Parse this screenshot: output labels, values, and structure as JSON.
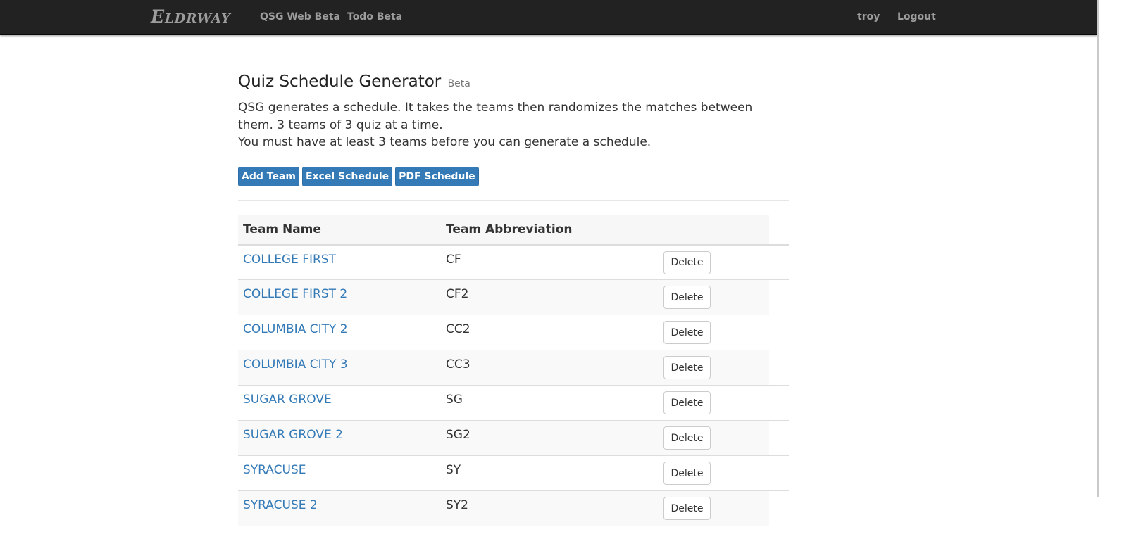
{
  "navbar": {
    "brand": "Eldrway",
    "links": [
      "QSG Web Beta",
      "Todo Beta"
    ],
    "user": "troy",
    "logout": "Logout"
  },
  "page": {
    "title": "Quiz Schedule Generator",
    "title_badge": "Beta",
    "description_1": "QSG generates a schedule. It takes the teams then randomizes the matches between them. 3 teams of 3 quiz at a time.",
    "description_2": "You must have at least 3 teams before you can generate a schedule."
  },
  "actions": {
    "add_team": "Add Team",
    "excel_schedule": "Excel Schedule",
    "pdf_schedule": "PDF Schedule"
  },
  "table": {
    "headers": [
      "Team Name",
      "Team Abbreviation",
      ""
    ],
    "delete_label": "Delete",
    "rows": [
      {
        "name": "COLLEGE FIRST",
        "abbr": "CF"
      },
      {
        "name": "COLLEGE FIRST 2",
        "abbr": "CF2"
      },
      {
        "name": "COLUMBIA CITY 2",
        "abbr": "CC2"
      },
      {
        "name": "COLUMBIA CITY 3",
        "abbr": "CC3"
      },
      {
        "name": "SUGAR GROVE",
        "abbr": "SG"
      },
      {
        "name": "SUGAR GROVE 2",
        "abbr": "SG2"
      },
      {
        "name": "SYRACUSE",
        "abbr": "SY"
      },
      {
        "name": "SYRACUSE 2",
        "abbr": "SY2"
      }
    ]
  },
  "colors": {
    "navbar_bg": "#222222",
    "primary": "#337ab7",
    "link": "#337ab7"
  }
}
